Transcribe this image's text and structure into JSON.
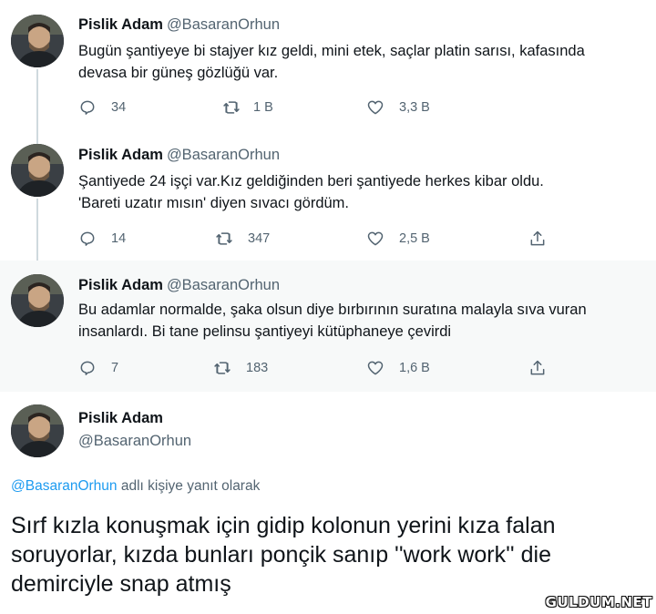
{
  "user": {
    "name": "Pislik Adam",
    "handle": "@BasaranOrhun"
  },
  "tweets": [
    {
      "text_lines": [
        "Bugün şantiyeye bi stajyer kız geldi, mini etek, saçlar platin sarısı, kafasında",
        "devasa bir güneş gözlüğü var."
      ],
      "replies": "34",
      "retweets": "1 B",
      "likes": "3,3 B"
    },
    {
      "text_lines": [
        "Şantiyede 24 işçi var.Kız geldiğinden beri şantiyede herkes kibar oldu.",
        "'Bareti uzatır mısın' diyen sıvacı gördüm."
      ],
      "replies": "14",
      "retweets": "347",
      "likes": "2,5 B"
    },
    {
      "text_lines": [
        "Bu adamlar normalde, şaka olsun diye bırbırının suratına malayla sıva vuran",
        "insanlardı. Bi tane pelinsu şantiyeyi kütüphaneye çevirdi"
      ],
      "replies": "7",
      "retweets": "183",
      "likes": "1,6 B"
    }
  ],
  "main_tweet": {
    "reply_to_mention": "@BasaranOrhun",
    "reply_to_suffix": " adlı kişiye yanıt olarak",
    "text_lines": [
      "Sırf kızla konuşmak için gidip kolonun yerini kıza falan",
      "soruyorlar, kızda bunları ponçik sanıp ''work work'' die",
      "demirciyle snap atmış"
    ]
  },
  "watermark": "GULDUM.NET",
  "colors": {
    "text": "#0f1419",
    "secondary": "#536471",
    "accent": "#1d9bf0",
    "highlight_bg": "#f7f9f9",
    "thread_line": "#cfd9de"
  },
  "icons": [
    "reply-icon",
    "retweet-icon",
    "like-icon",
    "share-icon"
  ]
}
